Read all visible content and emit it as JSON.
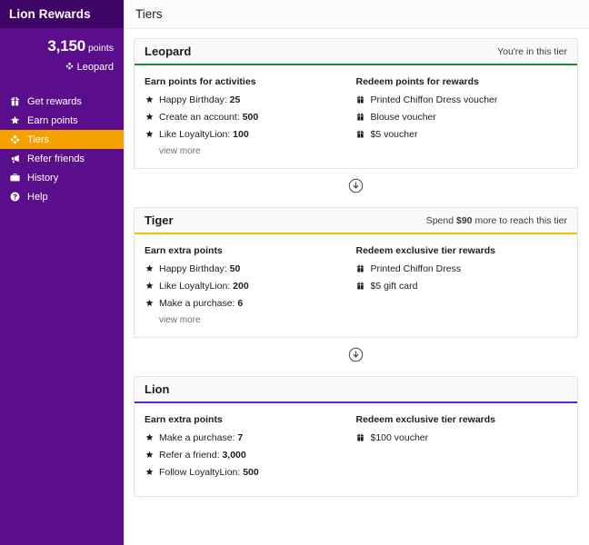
{
  "sidebar": {
    "title": "Lion Rewards",
    "points": {
      "value": "3,150",
      "label": "points"
    },
    "tier": {
      "name": "Leopard",
      "icon": "gem-icon"
    },
    "nav": [
      {
        "label": "Get rewards",
        "icon": "gift-icon",
        "active": false
      },
      {
        "label": "Earn points",
        "icon": "star-icon",
        "active": false
      },
      {
        "label": "Tiers",
        "icon": "gem-icon",
        "active": true
      },
      {
        "label": "Refer friends",
        "icon": "megaphone-icon",
        "active": false
      },
      {
        "label": "History",
        "icon": "briefcase-icon",
        "active": false
      },
      {
        "label": "Help",
        "icon": "question-circle-icon",
        "active": false
      }
    ]
  },
  "header": {
    "title": "Tiers"
  },
  "colors": {
    "sidebar_purple": "#5b0e8b",
    "sidebar_header_purple": "#3e0566",
    "active_orange": "#f5a200",
    "leopard_accent": "#1f8b3a",
    "tiger_accent": "#edc209",
    "lion_accent": "#5b22d6"
  },
  "connector": {
    "icon": "arrow-down-circle-icon",
    "count": 2
  },
  "tiers": [
    {
      "name": "Leopard",
      "status": "You're in this tier",
      "status_bold": "",
      "status_prefix": "You're in this tier",
      "status_suffix": "",
      "accent": "#1f8b3a",
      "earn": {
        "heading": "Earn points for activities",
        "items": [
          {
            "text": "Happy Birthday: ",
            "value": "25"
          },
          {
            "text": "Create an account: ",
            "value": "500"
          },
          {
            "text": "Like LoyaltyLion: ",
            "value": "100"
          }
        ],
        "view_more": "view more"
      },
      "redeem": {
        "heading": "Redeem points for rewards",
        "items": [
          {
            "text": "Printed Chiffon Dress voucher"
          },
          {
            "text": "Blouse voucher"
          },
          {
            "text": "$5 voucher"
          }
        ]
      }
    },
    {
      "name": "Tiger",
      "status": "Spend $90 more to reach this tier",
      "status_prefix": "Spend ",
      "status_bold": "$90",
      "status_suffix": " more to reach this tier",
      "accent": "#edc209",
      "earn": {
        "heading": "Earn extra points",
        "items": [
          {
            "text": "Happy Birthday: ",
            "value": "50"
          },
          {
            "text": "Like LoyaltyLion: ",
            "value": "200"
          },
          {
            "text": "Make a purchase: ",
            "value": "6"
          }
        ],
        "view_more": "view more"
      },
      "redeem": {
        "heading": "Redeem exclusive tier rewards",
        "items": [
          {
            "text": "Printed Chiffon Dress"
          },
          {
            "text": "$5 gift card"
          }
        ]
      }
    },
    {
      "name": "Lion",
      "status": "",
      "status_prefix": "",
      "status_bold": "",
      "status_suffix": "",
      "accent": "#5b22d6",
      "earn": {
        "heading": "Earn extra points",
        "items": [
          {
            "text": "Make a purchase: ",
            "value": "7"
          },
          {
            "text": "Refer a friend: ",
            "value": "3,000"
          },
          {
            "text": "Follow LoyaltyLion: ",
            "value": "500"
          }
        ],
        "view_more": ""
      },
      "redeem": {
        "heading": "Redeem exclusive tier rewards",
        "items": [
          {
            "text": "$100 voucher"
          }
        ]
      }
    }
  ]
}
